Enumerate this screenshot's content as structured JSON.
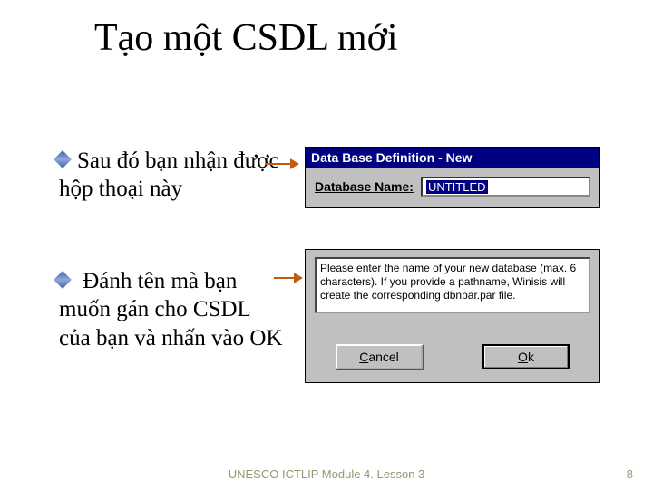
{
  "title": "Tạo một CSDL mới",
  "bullets": {
    "b1": "Sau đó bạn nhận được hộp thoại này",
    "b2": " Đánh tên mà bạn muốn gán cho CSDL của bạn và nhấn vào OK"
  },
  "dialog1": {
    "title": "Data Base Definition - New",
    "label": "Database Name:",
    "value": "UNTITLED"
  },
  "dialog2": {
    "message": "Please enter the name of your new database (max. 6 characters). If you provide a pathname, Winisis will create the corresponding dbnpar.par file.",
    "cancel": "Cancel",
    "ok": "Ok"
  },
  "footer": {
    "text": "UNESCO ICTLIP Module 4.  Lesson 3",
    "page": "8"
  }
}
